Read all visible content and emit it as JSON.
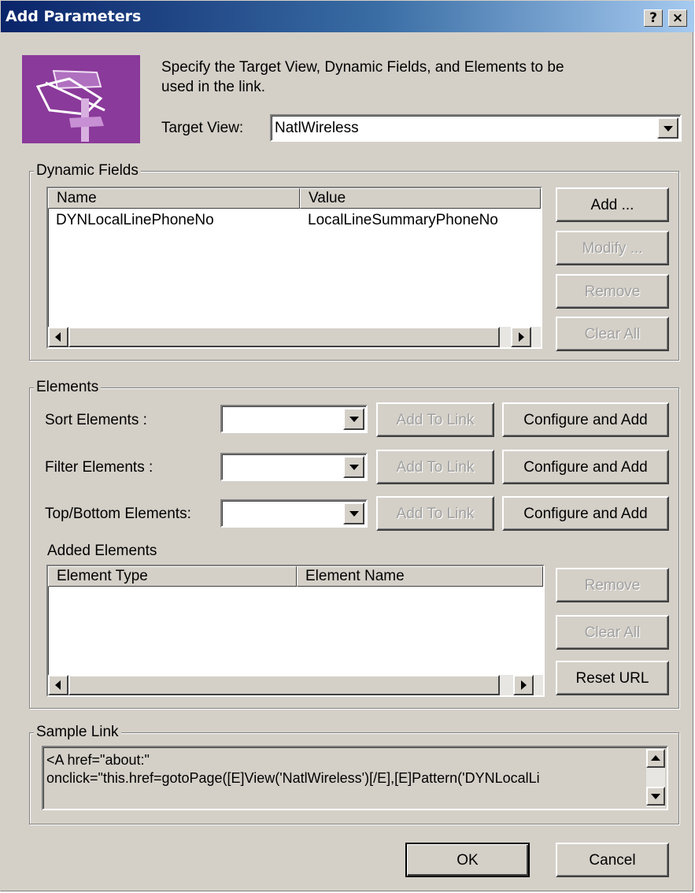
{
  "window": {
    "title": "Add Parameters",
    "help_button": "?",
    "close_button": "×"
  },
  "intro": {
    "instruction_line1": "Specify the Target View, Dynamic Fields, and Elements to be",
    "instruction_line2": "used in the link.",
    "target_view_label": "Target View:",
    "target_view_value": "NatlWireless"
  },
  "dynamic_fields": {
    "group_label": "Dynamic Fields",
    "columns": [
      "Name",
      "Value"
    ],
    "rows": [
      {
        "name": "DYNLocalLinePhoneNo",
        "value": "LocalLineSummaryPhoneNo"
      }
    ],
    "buttons": {
      "add": "Add ...",
      "modify": "Modify ...",
      "remove": "Remove",
      "clear_all": "Clear All"
    }
  },
  "elements": {
    "group_label": "Elements",
    "sort_label": "Sort Elements :",
    "filter_label": "Filter Elements :",
    "topbottom_label": "Top/Bottom Elements:",
    "add_to_link": "Add To Link",
    "configure_and_add": "Configure and Add",
    "added_elements_label": "Added Elements",
    "columns": [
      "Element Type",
      "Element Name"
    ],
    "buttons": {
      "remove": "Remove",
      "clear_all": "Clear All",
      "reset_url": "Reset URL"
    }
  },
  "sample_link": {
    "group_label": "Sample Link",
    "line1": "<A href=\"about:\"",
    "line2": "onclick=\"this.href=gotoPage([E]View('NatlWireless')[/E],[E]Pattern('DYNLocalLi"
  },
  "footer": {
    "ok": "OK",
    "cancel": "Cancel"
  },
  "colors": {
    "face": "#d4d0c8",
    "title_gradient_start": "#0a246a",
    "title_gradient_end": "#a6caf0",
    "icon_purple": "#8a3a9a",
    "disabled_text": "#a0a0a0"
  }
}
